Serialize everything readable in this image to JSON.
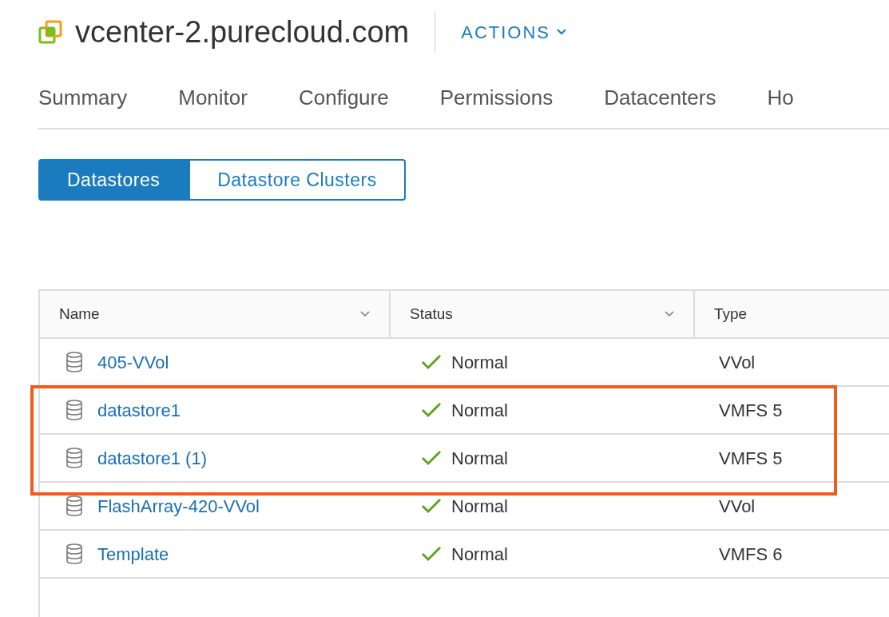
{
  "header": {
    "title": "vcenter-2.purecloud.com",
    "actions": "ACTIONS"
  },
  "tabs": [
    {
      "label": "Summary",
      "selected": false
    },
    {
      "label": "Monitor",
      "selected": false
    },
    {
      "label": "Configure",
      "selected": false
    },
    {
      "label": "Permissions",
      "selected": false
    },
    {
      "label": "Datacenters",
      "selected": false
    },
    {
      "label": "Ho",
      "selected": false
    }
  ],
  "segments": [
    {
      "label": "Datastores",
      "selected": true
    },
    {
      "label": "Datastore Clusters",
      "selected": false
    }
  ],
  "table": {
    "columns": [
      "Name",
      "Status",
      "Type"
    ],
    "rows": [
      {
        "name": "405-VVol",
        "status": "Normal",
        "type": "VVol",
        "highlighted": false
      },
      {
        "name": "datastore1",
        "status": "Normal",
        "type": "VMFS 5",
        "highlighted": true
      },
      {
        "name": "datastore1 (1)",
        "status": "Normal",
        "type": "VMFS 5",
        "highlighted": true
      },
      {
        "name": "FlashArray-420-VVol",
        "status": "Normal",
        "type": "VVol",
        "highlighted": false
      },
      {
        "name": "Template",
        "status": "Normal",
        "type": "VMFS 6",
        "highlighted": false
      }
    ]
  }
}
